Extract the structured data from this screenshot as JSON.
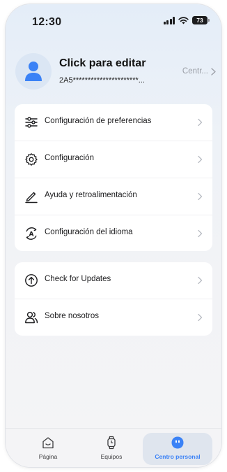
{
  "status_bar": {
    "time": "12:30",
    "battery": "73"
  },
  "profile": {
    "name": "Click para editar",
    "id": "2A5**********************...",
    "center_link": "Centr..."
  },
  "menu": {
    "group1": [
      {
        "label": "Configuración de preferencias",
        "icon": "sliders-icon"
      },
      {
        "label": "Configuración",
        "icon": "gear-icon"
      },
      {
        "label": "Ayuda y retroalimentación",
        "icon": "pencil-icon"
      },
      {
        "label": "Configuración del idioma",
        "icon": "language-icon"
      }
    ],
    "group2": [
      {
        "label": "Check for Updates",
        "icon": "arrow-up-circle-icon"
      },
      {
        "label": "Sobre nosotros",
        "icon": "users-icon"
      }
    ]
  },
  "tabs": [
    {
      "label": "Página",
      "icon": "home-icon"
    },
    {
      "label": "Equipos",
      "icon": "watch-icon"
    },
    {
      "label": "Centro personal",
      "icon": "face-icon",
      "active": true
    }
  ],
  "colors": {
    "accent": "#3b82f6",
    "active_pill": "#dfe5ee"
  }
}
